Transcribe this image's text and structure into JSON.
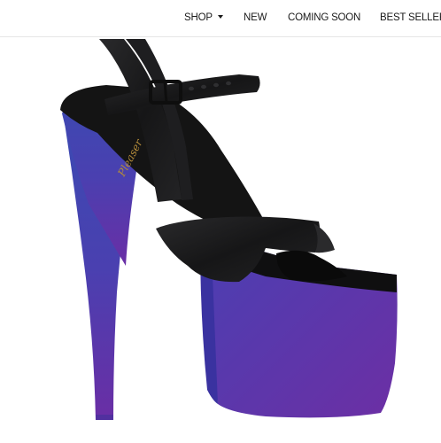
{
  "nav": {
    "items": [
      {
        "label": "SHOP",
        "has_dropdown": true
      },
      {
        "label": "NEW"
      },
      {
        "label": "COMING SOON"
      },
      {
        "label": "BEST SELLER"
      }
    ]
  },
  "product": {
    "image_subject": "platform-ankle-strap-sandal",
    "brand_logo_text": "Pleaser",
    "colors": {
      "upper": "#1c1c1e",
      "platform_top": "#3a49b0",
      "platform_bottom": "#6a2ea5",
      "insole": "#141414"
    }
  }
}
